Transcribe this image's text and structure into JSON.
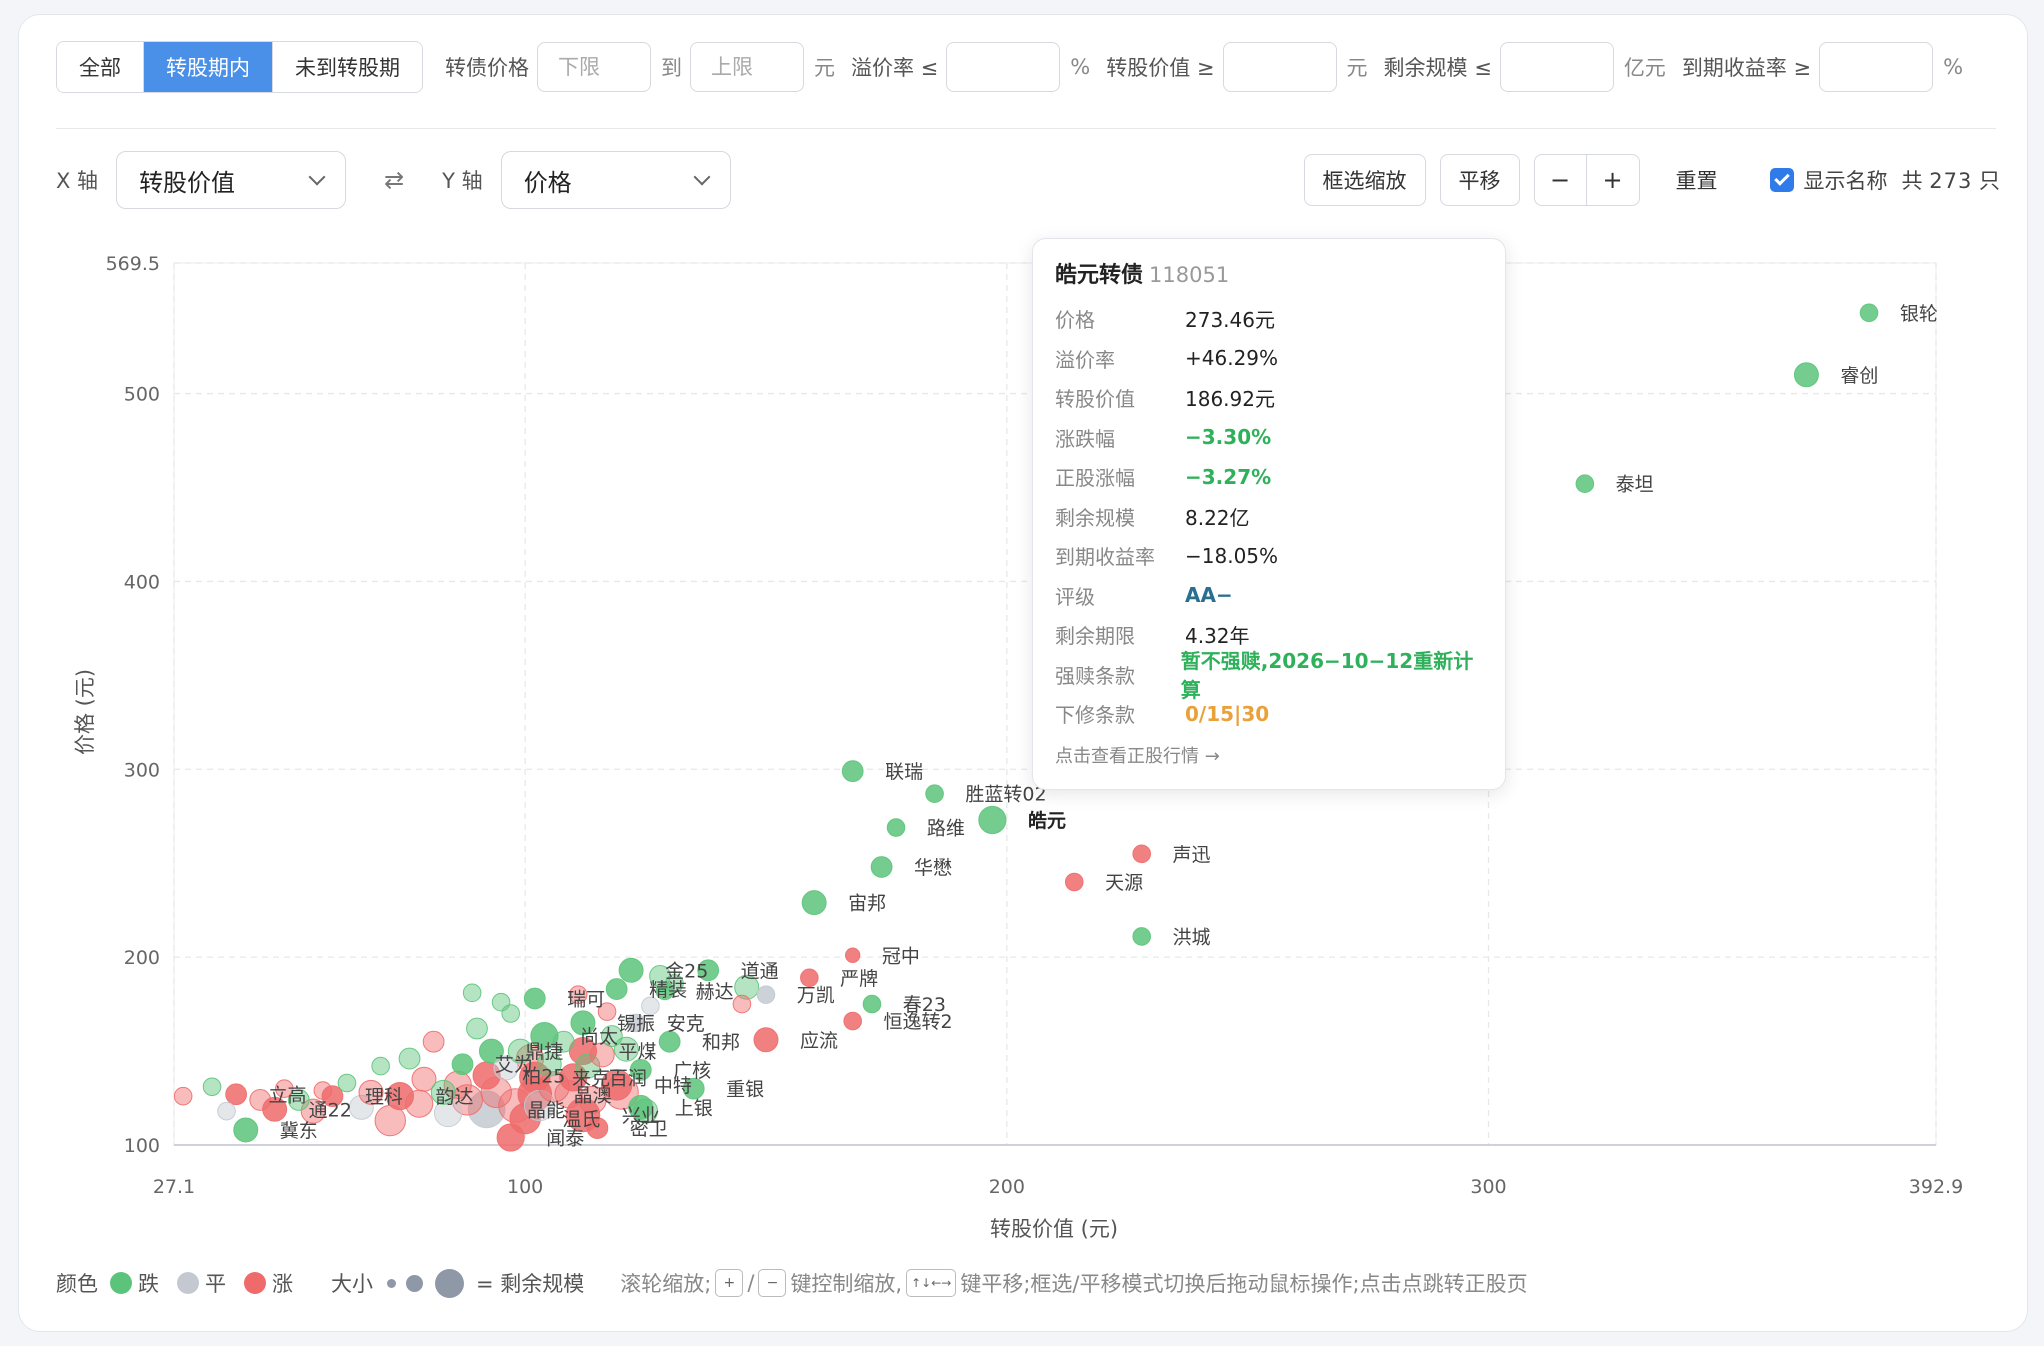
{
  "filters": {
    "segments": [
      "全部",
      "转股期内",
      "未到转股期"
    ],
    "active_segment": 1,
    "price_label": "转债价格",
    "lower_placeholder": "下限",
    "to_label": "到",
    "upper_placeholder": "上限",
    "yuan": "元",
    "premium_label": "溢价率 ≤",
    "percent": "%",
    "conv_value_label": "转股价值 ≥",
    "remaining_label": "剩余规模 ≤",
    "yi_yuan": "亿元",
    "ytm_label": "到期收益率 ≥"
  },
  "axisbar": {
    "x_label": "X 轴",
    "x_value": "转股价值",
    "swap": "⇄",
    "y_label": "Y 轴",
    "y_value": "价格",
    "box_zoom": "框选缩放",
    "pan": "平移",
    "minus": "−",
    "plus": "+",
    "reset": "重置",
    "show_names": "显示名称",
    "count_prefix": "共",
    "count": "273",
    "count_suffix": "只"
  },
  "colors": {
    "down": "#5cc47a",
    "flat": "#c4c9d1",
    "up": "#ef6b6b",
    "accent": "#4a90e8"
  },
  "chart_data": {
    "type": "scatter",
    "xlabel": "转股价值 (元)",
    "ylabel": "价格 (元)",
    "xlim": [
      27.1,
      392.9
    ],
    "ylim": [
      100,
      569.5
    ],
    "x_ticks": [
      27.1,
      100,
      200,
      300,
      392.9
    ],
    "y_ticks": [
      100,
      200,
      300,
      400,
      500,
      569.5
    ],
    "points": [
      {
        "name": "银轮",
        "x": 379,
        "y": 543,
        "trend": "down",
        "s": 3
      },
      {
        "name": "睿创",
        "x": 366,
        "y": 510,
        "trend": "down",
        "s": 5
      },
      {
        "name": "泰坦",
        "x": 320,
        "y": 452,
        "trend": "down",
        "s": 3
      },
      {
        "name": "联瑞",
        "x": 168,
        "y": 299,
        "trend": "down",
        "s": 4
      },
      {
        "name": "胜蓝转02",
        "x": 185,
        "y": 287,
        "trend": "down",
        "s": 3
      },
      {
        "name": "皓元",
        "x": 197,
        "y": 273,
        "trend": "down",
        "s": 6,
        "bold": true
      },
      {
        "name": "路维",
        "x": 177,
        "y": 269,
        "trend": "down",
        "s": 3
      },
      {
        "name": "华懋",
        "x": 174,
        "y": 248,
        "trend": "down",
        "s": 4
      },
      {
        "name": "声迅",
        "x": 228,
        "y": 255,
        "trend": "up",
        "s": 3
      },
      {
        "name": "天源",
        "x": 214,
        "y": 240,
        "trend": "up",
        "s": 3
      },
      {
        "name": "宙邦",
        "x": 160,
        "y": 229,
        "trend": "down",
        "s": 5
      },
      {
        "name": "洪城",
        "x": 228,
        "y": 211,
        "trend": "down",
        "s": 3
      },
      {
        "name": "冠中",
        "x": 168,
        "y": 201,
        "trend": "up",
        "s": 2
      },
      {
        "name": "严牌",
        "x": 159,
        "y": 189,
        "trend": "up",
        "s": 3
      },
      {
        "name": "春23",
        "x": 172,
        "y": 175,
        "trend": "down",
        "s": 3
      },
      {
        "name": "恒逸转2",
        "x": 168,
        "y": 166,
        "trend": "up",
        "s": 3
      },
      {
        "name": "道通",
        "x": 138,
        "y": 193,
        "trend": "down",
        "s": 4
      },
      {
        "name": "万凯",
        "x": 150,
        "y": 180,
        "trend": "flat",
        "s": 3
      },
      {
        "name": "金25",
        "x": 122,
        "y": 193,
        "trend": "down",
        "s": 5
      },
      {
        "name": "精装",
        "x": 119,
        "y": 183,
        "trend": "down",
        "s": 4
      },
      {
        "name": "赫达",
        "x": 129,
        "y": 182,
        "trend": "down",
        "s": 3
      },
      {
        "name": "瑞可",
        "x": 102,
        "y": 178,
        "trend": "down",
        "s": 4
      },
      {
        "name": "锡振",
        "x": 112,
        "y": 165,
        "trend": "down",
        "s": 5
      },
      {
        "name": "安克",
        "x": 123,
        "y": 165,
        "trend": "flat",
        "s": 3
      },
      {
        "name": "尚太",
        "x": 104,
        "y": 158,
        "trend": "down",
        "s": 6
      },
      {
        "name": "和邦",
        "x": 130,
        "y": 155,
        "trend": "down",
        "s": 4
      },
      {
        "name": "应流",
        "x": 150,
        "y": 156,
        "trend": "up",
        "s": 5
      },
      {
        "name": "鼎捷",
        "x": 93,
        "y": 150,
        "trend": "down",
        "s": 5
      },
      {
        "name": "平煤",
        "x": 112,
        "y": 150,
        "trend": "up",
        "s": 6
      },
      {
        "name": "艾为",
        "x": 87,
        "y": 143,
        "trend": "down",
        "s": 4
      },
      {
        "name": "广核",
        "x": 124,
        "y": 140,
        "trend": "down",
        "s": 4
      },
      {
        "name": "柏25",
        "x": 92,
        "y": 137,
        "trend": "up",
        "s": 6
      },
      {
        "name": "来克",
        "x": 102,
        "y": 136,
        "trend": "up",
        "s": 7
      },
      {
        "name": "百润",
        "x": 110,
        "y": 136,
        "trend": "up",
        "s": 6
      },
      {
        "name": "中特",
        "x": 119,
        "y": 132,
        "trend": "up",
        "s": 7
      },
      {
        "name": "重银",
        "x": 135,
        "y": 130,
        "trend": "down",
        "s": 4
      },
      {
        "name": "晶澳",
        "x": 102,
        "y": 127,
        "trend": "up",
        "s": 8
      },
      {
        "name": "理科",
        "x": 60,
        "y": 126,
        "trend": "up",
        "s": 4
      },
      {
        "name": "韵达",
        "x": 74,
        "y": 126,
        "trend": "up",
        "s": 6
      },
      {
        "name": "立高",
        "x": 40,
        "y": 127,
        "trend": "up",
        "s": 4
      },
      {
        "name": "通22",
        "x": 48,
        "y": 119,
        "trend": "up",
        "s": 5
      },
      {
        "name": "晶能",
        "x": 92,
        "y": 119,
        "trend": "flat",
        "s": 9
      },
      {
        "name": "上银",
        "x": 124,
        "y": 120,
        "trend": "down",
        "s": 5
      },
      {
        "name": "温氏",
        "x": 100,
        "y": 114,
        "trend": "up",
        "s": 7
      },
      {
        "name": "兴业",
        "x": 112,
        "y": 116,
        "trend": "up",
        "s": 8
      },
      {
        "name": "冀东",
        "x": 42,
        "y": 108,
        "trend": "down",
        "s": 5
      },
      {
        "name": "密卫",
        "x": 115,
        "y": 109,
        "trend": "up",
        "s": 4
      },
      {
        "name": "闻泰",
        "x": 97,
        "y": 104,
        "trend": "up",
        "s": 6
      },
      {
        "name": "",
        "x": 29,
        "y": 126,
        "trend": "up",
        "s": 3
      },
      {
        "name": "",
        "x": 35,
        "y": 131,
        "trend": "down",
        "s": 3
      },
      {
        "name": "",
        "x": 38,
        "y": 118,
        "trend": "flat",
        "s": 3
      },
      {
        "name": "",
        "x": 45,
        "y": 124,
        "trend": "up",
        "s": 4
      },
      {
        "name": "",
        "x": 50,
        "y": 130,
        "trend": "up",
        "s": 3
      },
      {
        "name": "",
        "x": 53,
        "y": 124,
        "trend": "down",
        "s": 4
      },
      {
        "name": "",
        "x": 56,
        "y": 118,
        "trend": "up",
        "s": 5
      },
      {
        "name": "",
        "x": 58,
        "y": 129,
        "trend": "up",
        "s": 3
      },
      {
        "name": "",
        "x": 63,
        "y": 133,
        "trend": "down",
        "s": 3
      },
      {
        "name": "",
        "x": 66,
        "y": 120,
        "trend": "flat",
        "s": 5
      },
      {
        "name": "",
        "x": 68,
        "y": 128,
        "trend": "up",
        "s": 5
      },
      {
        "name": "",
        "x": 70,
        "y": 142,
        "trend": "down",
        "s": 3
      },
      {
        "name": "",
        "x": 72,
        "y": 113,
        "trend": "up",
        "s": 7
      },
      {
        "name": "",
        "x": 76,
        "y": 146,
        "trend": "down",
        "s": 4
      },
      {
        "name": "",
        "x": 78,
        "y": 122,
        "trend": "up",
        "s": 6
      },
      {
        "name": "",
        "x": 79,
        "y": 135,
        "trend": "up",
        "s": 5
      },
      {
        "name": "",
        "x": 81,
        "y": 155,
        "trend": "up",
        "s": 4
      },
      {
        "name": "",
        "x": 83,
        "y": 128,
        "trend": "down",
        "s": 5
      },
      {
        "name": "",
        "x": 84,
        "y": 117,
        "trend": "flat",
        "s": 6
      },
      {
        "name": "",
        "x": 86,
        "y": 132,
        "trend": "up",
        "s": 6
      },
      {
        "name": "",
        "x": 88,
        "y": 124,
        "trend": "up",
        "s": 7
      },
      {
        "name": "",
        "x": 89,
        "y": 181,
        "trend": "down",
        "s": 3
      },
      {
        "name": "",
        "x": 90,
        "y": 162,
        "trend": "down",
        "s": 4
      },
      {
        "name": "",
        "x": 94,
        "y": 128,
        "trend": "up",
        "s": 7
      },
      {
        "name": "",
        "x": 95,
        "y": 176,
        "trend": "down",
        "s": 3
      },
      {
        "name": "",
        "x": 96,
        "y": 141,
        "trend": "flat",
        "s": 5
      },
      {
        "name": "",
        "x": 97,
        "y": 170,
        "trend": "down",
        "s": 3
      },
      {
        "name": "",
        "x": 98,
        "y": 121,
        "trend": "up",
        "s": 8
      },
      {
        "name": "",
        "x": 99,
        "y": 150,
        "trend": "down",
        "s": 5
      },
      {
        "name": "",
        "x": 101,
        "y": 146,
        "trend": "up",
        "s": 6
      },
      {
        "name": "",
        "x": 103,
        "y": 121,
        "trend": "flat",
        "s": 7
      },
      {
        "name": "",
        "x": 105,
        "y": 143,
        "trend": "down",
        "s": 5
      },
      {
        "name": "",
        "x": 106,
        "y": 131,
        "trend": "up",
        "s": 7
      },
      {
        "name": "",
        "x": 108,
        "y": 155,
        "trend": "down",
        "s": 4
      },
      {
        "name": "",
        "x": 109,
        "y": 127,
        "trend": "up",
        "s": 6
      },
      {
        "name": "",
        "x": 111,
        "y": 180,
        "trend": "up",
        "s": 3
      },
      {
        "name": "",
        "x": 113,
        "y": 142,
        "trend": "down",
        "s": 5
      },
      {
        "name": "",
        "x": 114,
        "y": 124,
        "trend": "up",
        "s": 6
      },
      {
        "name": "",
        "x": 116,
        "y": 148,
        "trend": "up",
        "s": 5
      },
      {
        "name": "",
        "x": 117,
        "y": 171,
        "trend": "up",
        "s": 3
      },
      {
        "name": "",
        "x": 118,
        "y": 158,
        "trend": "down",
        "s": 4
      },
      {
        "name": "",
        "x": 120,
        "y": 128,
        "trend": "up",
        "s": 8
      },
      {
        "name": "",
        "x": 121,
        "y": 151,
        "trend": "down",
        "s": 5
      },
      {
        "name": "",
        "x": 125,
        "y": 118,
        "trend": "down",
        "s": 5
      },
      {
        "name": "",
        "x": 126,
        "y": 174,
        "trend": "flat",
        "s": 3
      },
      {
        "name": "",
        "x": 128,
        "y": 190,
        "trend": "down",
        "s": 4
      },
      {
        "name": "",
        "x": 131,
        "y": 186,
        "trend": "down",
        "s": 3
      },
      {
        "name": "",
        "x": 145,
        "y": 175,
        "trend": "up",
        "s": 3
      },
      {
        "name": "",
        "x": 146,
        "y": 184,
        "trend": "down",
        "s": 5
      }
    ]
  },
  "tooltip": {
    "title": "皓元转债",
    "code": "118051",
    "rows": [
      {
        "k": "价格",
        "v": "273.46元",
        "c": "#222"
      },
      {
        "k": "溢价率",
        "v": "+46.29%",
        "c": "#222"
      },
      {
        "k": "转股价值",
        "v": "186.92元",
        "c": "#222"
      },
      {
        "k": "涨跌幅",
        "v": "−3.30%",
        "c": "#2fb15b"
      },
      {
        "k": "正股涨幅",
        "v": "−3.27%",
        "c": "#2fb15b"
      },
      {
        "k": "剩余规模",
        "v": "8.22亿",
        "c": "#222"
      },
      {
        "k": "到期收益率",
        "v": "−18.05%",
        "c": "#222"
      },
      {
        "k": "评级",
        "v": "AA−",
        "c": "#2a6f8f"
      },
      {
        "k": "剩余期限",
        "v": "4.32年",
        "c": "#222"
      },
      {
        "k": "强赎条款",
        "v": "暂不强赎,2026−10−12重新计算",
        "c": "#2fb15b"
      },
      {
        "k": "下修条款",
        "v": "0/15|30",
        "c": "#e9a23b"
      }
    ],
    "link": "点击查看正股行情 →"
  },
  "legend": {
    "color_label": "颜色",
    "down": "跌",
    "flat": "平",
    "up": "涨",
    "size_label": "大小",
    "size_eq": "= 剩余规模",
    "hint1": "滚轮缩放;",
    "key_plus": "+",
    "slash": "/",
    "key_minus": "−",
    "hint2": "键控制缩放,",
    "key_arrows": "↑↓←→",
    "hint3": "键平移;框选/平移模式切换后拖动鼠标操作;点击点跳转正股页"
  }
}
